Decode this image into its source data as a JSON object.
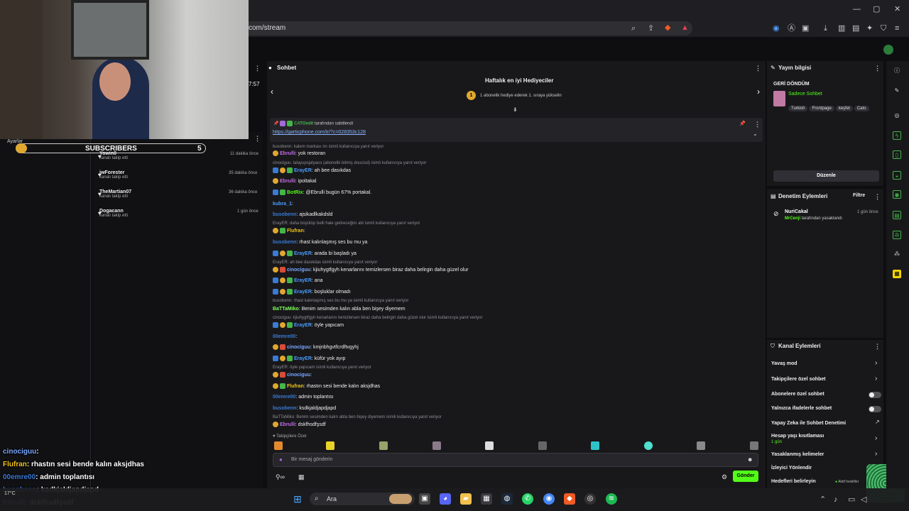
{
  "browser": {
    "url": "com/stream"
  },
  "webcam_time": "7:57",
  "subs_overlay": {
    "settings_label": "Ayarlar",
    "title": "SUBSCRIBERS",
    "count": "5"
  },
  "followers": [
    {
      "name": "Yowin0",
      "action": "kanalı takip etti",
      "time": "11 dakika önce"
    },
    {
      "name": "iwForester",
      "action": "kanalı takip etti",
      "time": "35 dakika önce"
    },
    {
      "name": "TheMartian07",
      "action": "kanalı takip etti",
      "time": "36 dakika önce"
    },
    {
      "name": "Dogacann",
      "action": "kanalı takip etti",
      "time": "1 gün önce"
    }
  ],
  "chat": {
    "header": "Sohbet",
    "gifters_title": "Haftalık en iyi Hediyeciler",
    "gifters_rank": "1",
    "gifters_sub": "1 abonelik hediye ederek 1. sıraya yükselin",
    "pinned_user": "CATOedit",
    "pinned_by": "tarafından sabitlendi",
    "pinned_link": "https://garticphone.com/tr/?c=028353c128",
    "messages": [
      {
        "reply": "busobenn: kalem markası mı isimli kullanıcıya yanıt veriyor"
      },
      {
        "user": "Ebrulli",
        "text": ": yok restoran"
      },
      {
        "reply": "cinociguu: lalayupsjalyaco (abonelik bitmiş doucisd) isimli kullanıcıya yanıt veriyor"
      },
      {
        "user": "ErayER",
        "text": ": ah bee dasıkdas"
      },
      {
        "user": "Ebrulli",
        "text": ": ipoltakal"
      },
      {
        "user": "BotRix",
        "text": ": @Ebrulli bugün 67% portakal."
      },
      {
        "user": "kubra_1",
        "text": ":"
      },
      {
        "user": "busobenn",
        "text": ": ajsikadlkakdsld"
      },
      {
        "reply": "ErayER: daha büyütüp belli hale getireceğim abi isimli kullanıcıya yanıt veriyor"
      },
      {
        "user": "Flufran",
        "text": ":"
      },
      {
        "user": "busobenn",
        "text": ": rhast kalınlaşmış ses bu mu ya"
      },
      {
        "user": "ErayER",
        "text": ": arada bi başladı ya"
      },
      {
        "reply": "ErayER: ah bee dasıkdas isimli kullanıcıya yanıt veriyor"
      },
      {
        "user": "cinociguu",
        "text": ": kjiuhygtfgyh kenarlarını temizlersen biraz daha belirgin daha güzel olur"
      },
      {
        "user": "ErayER",
        "text": ": ana"
      },
      {
        "user": "ErayER",
        "text": ": boşluklar olmadı"
      },
      {
        "reply": "busobenn: rhast kalınlaşmış ses bu mu ya isimli kullanıcıya yanıt veriyor"
      },
      {
        "user": "BaTTaMiko",
        "text": ": Benim sesimden kalın abla ben bişey diyemem"
      },
      {
        "reply": "cinociguu: kjiuhygtfgyh kenarlarını temizlersen biraz daha belirgin daha güzel olur isimli kullanıcıya yanıt veriyor"
      },
      {
        "user": "ErayER",
        "text": ": öyle yapıcam"
      },
      {
        "user": "00emre00",
        "text": ":"
      },
      {
        "user": "cinociguu",
        "text": ": kmjnbhgvtfcrdftvgyhj"
      },
      {
        "user": "ErayER",
        "text": ": küfür yok ayıp"
      },
      {
        "reply": "ErayER: öyle yapıcam isimli kullanıcıya yanıt veriyor"
      },
      {
        "user": "cinociguu",
        "text": ":"
      },
      {
        "user": "Flufran",
        "text": ": rhastın sesi bende kalın aksjdhas"
      },
      {
        "user": "00emre00",
        "text": ": admin toplantısı"
      },
      {
        "user": "busobenn",
        "text": ": ksdkjaldjapdjapd"
      },
      {
        "reply": "BaTTaMiko: Benim sesimden kalın abla ben bişey diyemem isimli kullanıcıya yanıt veriyor"
      },
      {
        "user": "Ebrulli",
        "text": ": dskfhsdfşsdf"
      }
    ],
    "follower_only": "Takipçilere Özel",
    "input_placeholder": "Bir mesaj gönderin",
    "send_label": "Gönder"
  },
  "stream_info": {
    "header": "Yayın bilgisi",
    "title": "GERİ DÖNDÜM",
    "category": "Sadece Sohbet",
    "tags": [
      "Turkish",
      "Frontpage",
      "keşfet",
      "Cato"
    ],
    "edit_label": "Düzenle"
  },
  "mod_actions": {
    "header": "Denetim Eylemleri",
    "filter_label": "Filtre",
    "entry_user": "NuriCakal",
    "entry_mod": "MrCenji",
    "entry_action": "tarafından yasaklandı",
    "entry_time": "1 gün önce"
  },
  "channel_actions": {
    "header": "Kanal Eylemleri",
    "items": [
      "Yavaş mod",
      "Takipçilere özel sohbet",
      "Abonelere özel sohbet",
      "Yalnızca ifadelerle sohbet",
      "Yapay Zeka ile Sohbet Denetimi",
      "Hesap yaşı kısıtlaması",
      "Yasaklanmış kelimeler",
      "İzleyici Yönlendir",
      "Hedefleri belirleyin"
    ],
    "account_age_value": "1 gün",
    "goal_status": "Aktif hedefler"
  },
  "overlay_chat": [
    {
      "user": "cinociguu",
      "text": ":"
    },
    {
      "user": "Flufran",
      "text": ": rhastın sesi bende kalın aksjdhas"
    },
    {
      "user": "00emre00",
      "text": ": admin toplantısı"
    },
    {
      "user": "busobenn",
      "text": ": ksdkjaldjapdjapd"
    },
    {
      "user": "Ebrulli",
      "text": ": dskfhsdfşsdf"
    }
  ],
  "taskbar": {
    "search_label": "Ara",
    "temperature": "17°C"
  },
  "colors": {
    "accent": "#53fc18",
    "bg": "#0e0e10",
    "panel": "#18181b",
    "link": "#3a7bd5"
  }
}
